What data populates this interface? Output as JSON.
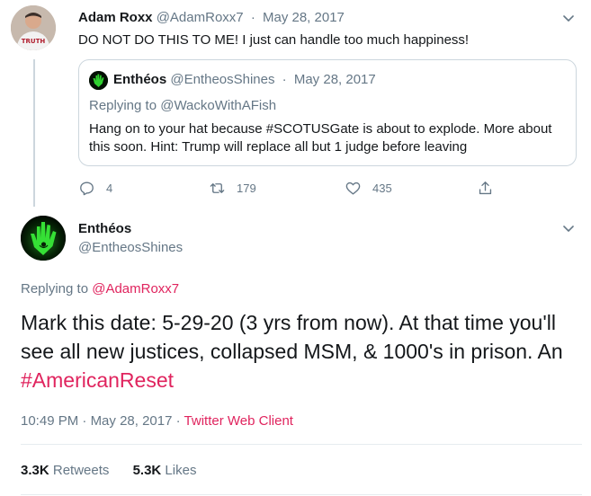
{
  "parent_tweet": {
    "name": "Adam Roxx",
    "handle": "@AdamRoxx7",
    "dot": "·",
    "date": "May 28, 2017",
    "text": "DO NOT DO THIS TO ME! I just can handle too much happiness!",
    "avatar_shirt_text": "TRUTH",
    "quoted": {
      "name": "Enthéos",
      "handle": "@EntheosShines",
      "dot": "·",
      "date": "May 28, 2017",
      "replying_prefix": "Replying to",
      "replying_to": "@WackoWithAFish",
      "text": "Hang on to your hat because #SCOTUSGate is about to explode. More about this soon.  Hint: Trump will replace all but 1 judge before leaving"
    },
    "actions": {
      "reply_count": "4",
      "retweet_count": "179",
      "like_count": "435"
    }
  },
  "main_tweet": {
    "name": "Enthéos",
    "handle": "@EntheosShines",
    "replying_prefix": "Replying to",
    "replying_to": "@AdamRoxx7",
    "text_before": "Mark this date:  5-29-20 (3 yrs from now).  At that time you'll see all new justices, collapsed MSM, & 1000's in prison.  An ",
    "hashtag": "#AmericanReset",
    "time": "10:49 PM",
    "meta_dot": "·",
    "date": "May 28, 2017",
    "meta_dot2": "·",
    "client": "Twitter Web Client",
    "retweets_count": "3.3K",
    "retweets_label": "Retweets",
    "likes_count": "5.3K",
    "likes_label": "Likes"
  },
  "colors": {
    "link": "#e0245e",
    "secondary_text": "#657786",
    "primary_text": "#14171a",
    "border": "#ccd6dd"
  },
  "icons": [
    "chevron-down-icon",
    "reply-icon",
    "retweet-icon",
    "like-icon",
    "share-icon"
  ]
}
